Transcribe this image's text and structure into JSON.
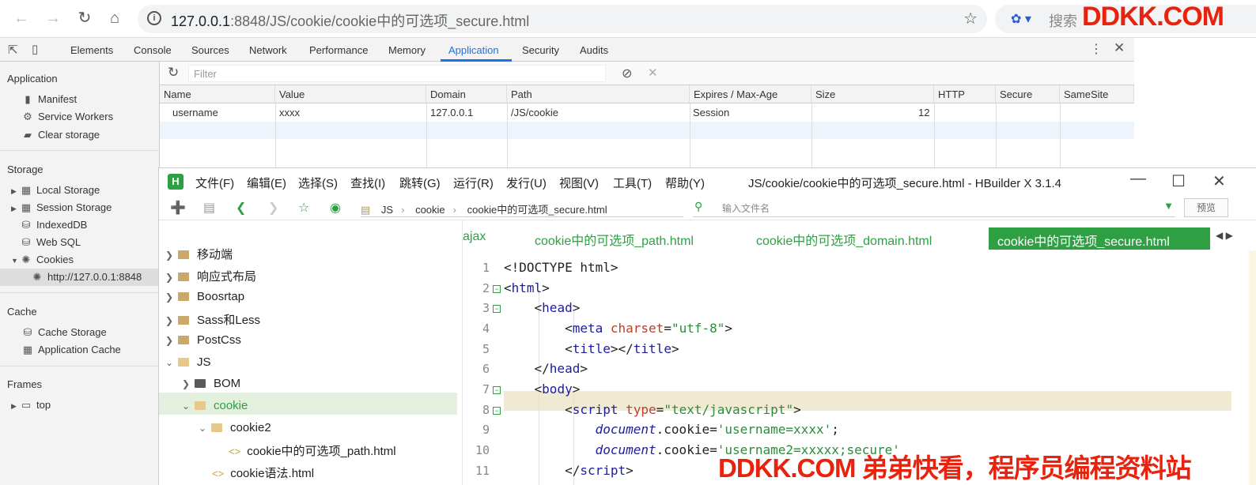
{
  "browser": {
    "url_host": "127.0.0.1",
    "url_rest": ":8848/JS/cookie/cookie中的可选项_secure.html",
    "search_label": "搜索",
    "brand": "DDKK.COM"
  },
  "devtools": {
    "tabs": [
      "Elements",
      "Console",
      "Sources",
      "Network",
      "Performance",
      "Memory",
      "Application",
      "Security",
      "Audits"
    ],
    "sidebar": {
      "application_head": "Application",
      "application_items": [
        "Manifest",
        "Service Workers",
        "Clear storage"
      ],
      "storage_head": "Storage",
      "storage_items": [
        "Local Storage",
        "Session Storage",
        "IndexedDB",
        "Web SQL",
        "Cookies"
      ],
      "cookie_origin": "http://127.0.0.1:8848",
      "cache_head": "Cache",
      "cache_items": [
        "Cache Storage",
        "Application Cache"
      ],
      "frames_head": "Frames",
      "frames_items": [
        "top"
      ]
    },
    "filter_placeholder": "Filter",
    "table": {
      "columns": [
        "Name",
        "Value",
        "Domain",
        "Path",
        "Expires / Max-Age",
        "Size",
        "HTTP",
        "Secure",
        "SameSite"
      ],
      "rows": [
        {
          "name": "username",
          "value": "xxxx",
          "domain": "127.0.0.1",
          "path": "/JS/cookie",
          "expires": "Session",
          "size": "12"
        }
      ]
    }
  },
  "hbuilder": {
    "logo": "H",
    "menu": [
      "文件(F)",
      "编辑(E)",
      "选择(S)",
      "查找(I)",
      "跳转(G)",
      "运行(R)",
      "发行(U)",
      "视图(V)",
      "工具(T)",
      "帮助(Y)"
    ],
    "title": "JS/cookie/cookie中的可选项_secure.html - HBuilder X 3.1.4",
    "breadcrumb": [
      "JS",
      "cookie",
      "cookie中的可选项_secure.html"
    ],
    "file_input_placeholder": "输入文件名",
    "preview_label": "预览",
    "tree": [
      "移动端",
      "响应式布局",
      "Boosrtap",
      "Sass和Less",
      "PostCss",
      "JS",
      "BOM",
      "cookie",
      "cookie2",
      "cookie中的可选项_path.html",
      "cookie语法.html"
    ],
    "tabs": [
      "ajax",
      "cookie中的可选项_path.html",
      "cookie中的可选项_domain.html"
    ],
    "active_tab": "cookie中的可选项_secure.html",
    "line_numbers": [
      "1",
      "2",
      "3",
      "4",
      "5",
      "6",
      "7",
      "8",
      "9",
      "10",
      "11"
    ]
  },
  "watermark": "DDKK.COM 弟弟快看，程序员编程资料站"
}
